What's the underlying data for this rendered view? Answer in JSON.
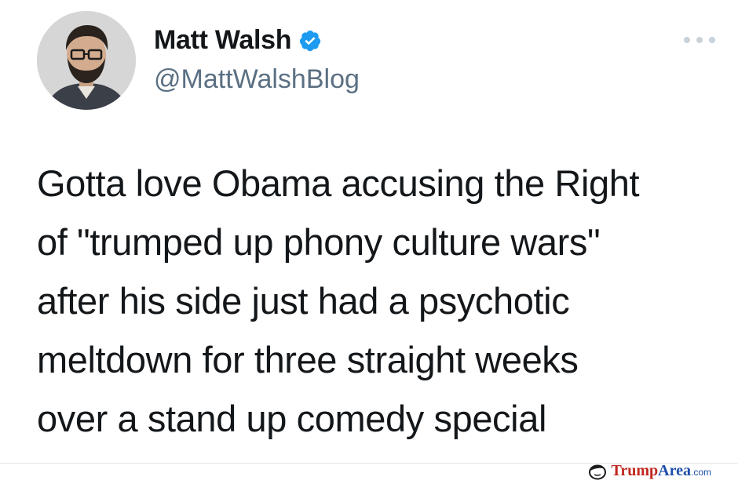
{
  "tweet": {
    "author": {
      "name": "Matt Walsh",
      "handle": "@MattWalshBlog",
      "verified": true,
      "avatar_icon": "profile-photo"
    },
    "more_icon": "ellipsis-icon",
    "text_lines": [
      "Gotta love Obama accusing the Right",
      "of \"trumped up phony culture wars\"",
      "after his side just had a psychotic",
      "meltdown for three straight weeks",
      "over a stand up comedy special"
    ]
  },
  "watermark": {
    "part1": "Trump",
    "part2": "Area",
    "part3": ".com"
  },
  "colors": {
    "text": "#14171a",
    "handle": "#5b7083",
    "verified": "#1d9bf0",
    "watermark_red": "#c0271e",
    "watermark_blue": "#1f4ea8"
  }
}
